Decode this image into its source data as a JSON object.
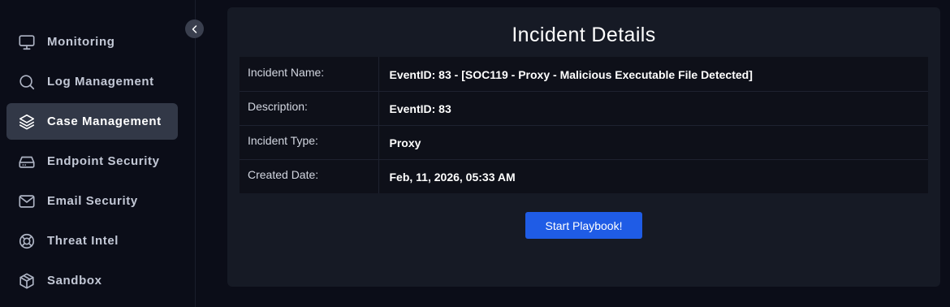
{
  "sidebar": {
    "items": [
      {
        "label": "Monitoring",
        "icon": "monitor-icon",
        "active": false
      },
      {
        "label": "Log Management",
        "icon": "search-icon",
        "active": false
      },
      {
        "label": "Case Management",
        "icon": "layers-icon",
        "active": true
      },
      {
        "label": "Endpoint Security",
        "icon": "hard-drive-icon",
        "active": false
      },
      {
        "label": "Email Security",
        "icon": "mail-icon",
        "active": false
      },
      {
        "label": "Threat Intel",
        "icon": "lifebuoy-icon",
        "active": false
      },
      {
        "label": "Sandbox",
        "icon": "box-icon",
        "active": false
      }
    ]
  },
  "panel": {
    "title": "Incident Details",
    "rows": [
      {
        "key": "Incident Name:",
        "value": "EventID: 83 - [SOC119 - Proxy - Malicious Executable File Detected]"
      },
      {
        "key": "Description:",
        "value": "EventID: 83"
      },
      {
        "key": "Incident Type:",
        "value": "Proxy"
      },
      {
        "key": "Created Date:",
        "value": "Feb, 11, 2026, 05:33 AM"
      }
    ],
    "button_label": "Start Playbook!"
  },
  "colors": {
    "background": "#0b0d18",
    "panel": "#161a25",
    "active_nav": "#323847",
    "accent": "#1f5ce6"
  }
}
